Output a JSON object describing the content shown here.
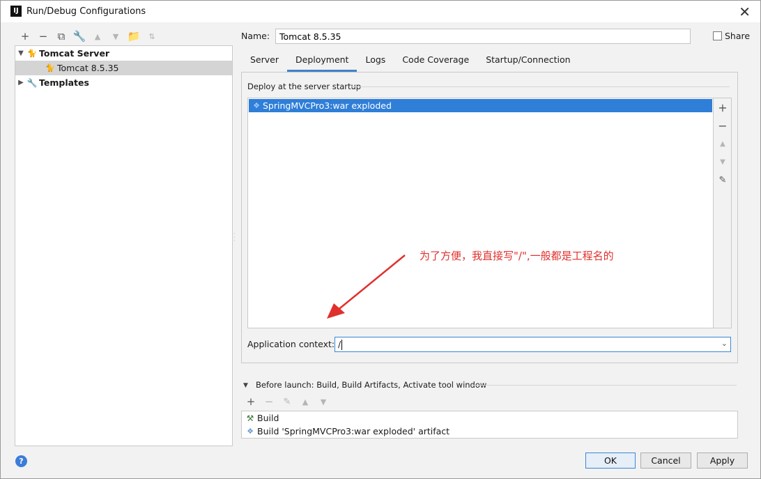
{
  "window": {
    "title": "Run/Debug Configurations",
    "app_icon": "IJ"
  },
  "tree": {
    "items": [
      {
        "label": "Tomcat Server",
        "icon": "tomcat-icon",
        "expanded": true,
        "bold": true
      },
      {
        "label": "Tomcat 8.5.35",
        "icon": "tomcat-icon",
        "selected": true
      },
      {
        "label": "Templates",
        "icon": "wrench-icon",
        "expanded": false,
        "bold": true
      }
    ]
  },
  "config": {
    "name_label": "Name:",
    "name_value": "Tomcat 8.5.35",
    "share_label": "Share",
    "share_checked": false
  },
  "tabs": [
    {
      "label": "Server",
      "active": false
    },
    {
      "label": "Deployment",
      "active": true
    },
    {
      "label": "Logs",
      "active": false
    },
    {
      "label": "Code Coverage",
      "active": false
    },
    {
      "label": "Startup/Connection",
      "active": false
    }
  ],
  "deployment": {
    "group_title": "Deploy at the server startup",
    "items": [
      {
        "label": "SpringMVCPro3:war exploded",
        "selected": true
      }
    ],
    "app_context_label": "Application context:",
    "app_context_value": "/"
  },
  "annotation": {
    "text": "为了方便，我直接写\"/\",一般都是工程名的",
    "color": "#e0302d"
  },
  "before_launch": {
    "title": "Before launch: Build, Build Artifacts, Activate tool window",
    "items": [
      {
        "label": "Build",
        "icon": "hammer-icon"
      },
      {
        "label": "Build 'SpringMVCPro3:war exploded' artifact",
        "icon": "artifact-icon"
      }
    ]
  },
  "buttons": {
    "ok": "OK",
    "cancel": "Cancel",
    "apply": "Apply"
  },
  "colors": {
    "selection": "#2f7ed8",
    "accent": "#4083c9",
    "annotation": "#e0302d"
  }
}
